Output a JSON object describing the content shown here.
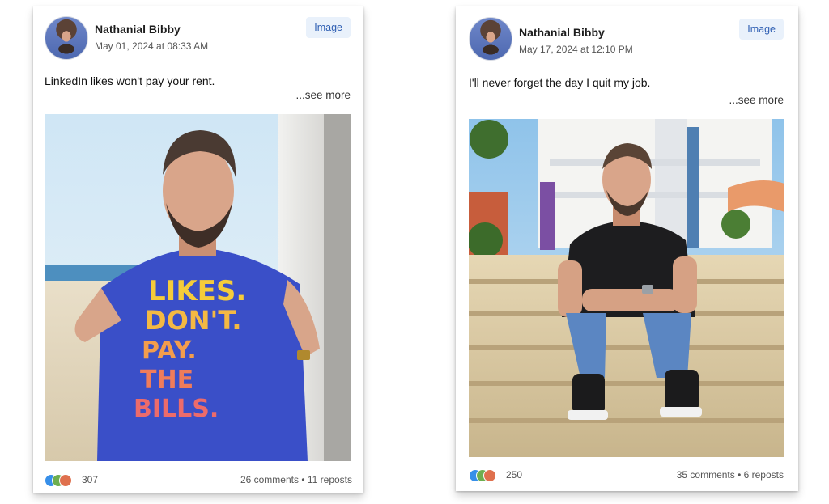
{
  "posts": [
    {
      "author": "Nathanial Bibby",
      "date": "May 01, 2024 at 08:33 AM",
      "badge": "Image",
      "caption": "LinkedIn likes won't pay your rent.",
      "see_more": "...see more",
      "shirt_text": [
        "LIKES.",
        "DON'T.",
        "PAY.",
        "THE",
        "BILLS."
      ],
      "reaction_count": "307",
      "stats": "26 comments • 11 reposts"
    },
    {
      "author": "Nathanial Bibby",
      "date": "May 17, 2024 at 12:10 PM",
      "badge": "Image",
      "caption": "I'll never forget the day I quit my job.",
      "see_more": "...see more",
      "reaction_count": "250",
      "stats": "35 comments • 6 reposts"
    }
  ],
  "colors": {
    "badge_bg": "#e9f1fb",
    "badge_text": "#2f5fb3",
    "reaction_like": "#378fe9",
    "reaction_celebrate": "#6dae4f",
    "reaction_love": "#df704d"
  },
  "icons": [
    "avatar",
    "like-reaction-icon",
    "celebrate-reaction-icon",
    "love-reaction-icon"
  ]
}
